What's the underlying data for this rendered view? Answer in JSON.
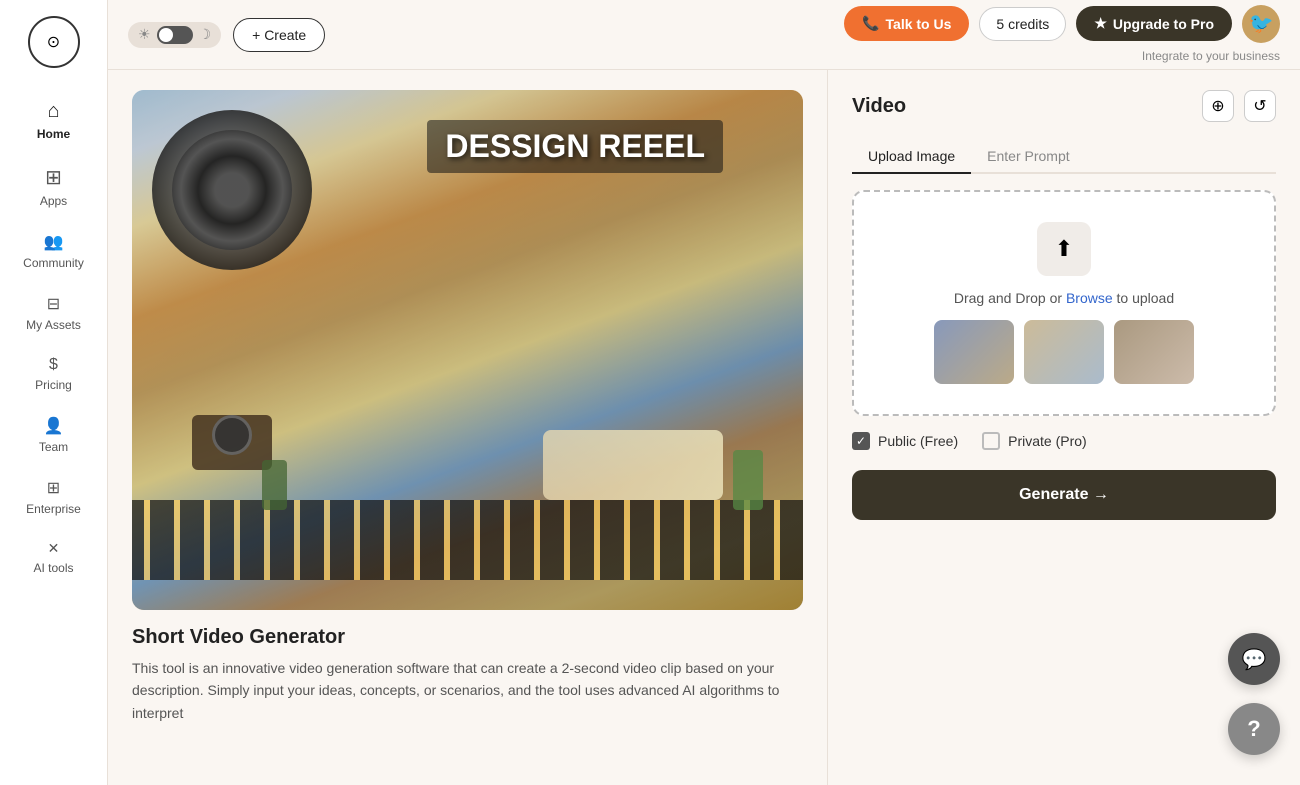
{
  "sidebar": {
    "logo_symbol": "⊙",
    "items": [
      {
        "id": "home",
        "label": "Home",
        "icon": "⌂"
      },
      {
        "id": "apps",
        "label": "Apps",
        "icon": "⊞"
      },
      {
        "id": "community",
        "label": "Community",
        "icon": "👥"
      },
      {
        "id": "my-assets",
        "label": "My Assets",
        "icon": "⊟"
      },
      {
        "id": "pricing",
        "label": "Pricing",
        "icon": "$"
      },
      {
        "id": "team",
        "label": "Team",
        "icon": "👤"
      },
      {
        "id": "enterprise",
        "label": "Enterprise",
        "icon": "⊞"
      },
      {
        "id": "ai-tools",
        "label": "AI tools",
        "icon": "✕"
      }
    ]
  },
  "header": {
    "theme_toggle": {
      "sun_icon": "☀",
      "moon_icon": "☽"
    },
    "create_label": "+ Create",
    "integrate_text": "Integrate to your business",
    "talk_btn_label": "Talk to Us",
    "credits_label": "5 credits",
    "upgrade_label": "Upgrade to Pro",
    "avatar_emoji": "🐦"
  },
  "main": {
    "tool": {
      "title": "Short Video Generator",
      "description": "This tool is an innovative video generation software that can create a 2-second video clip based on your description. Simply input your ideas, concepts, or scenarios, and the tool uses advanced AI algorithms to interpret",
      "preview_overlay": "DESSIGN REEEL"
    },
    "right_panel": {
      "title": "Video",
      "tabs": [
        {
          "id": "upload",
          "label": "Upload Image",
          "active": true
        },
        {
          "id": "prompt",
          "label": "Enter Prompt",
          "active": false
        }
      ],
      "upload": {
        "drag_text": "Drag and Drop or ",
        "browse_text": "Browse",
        "after_text": " to upload",
        "upload_icon": "⬆"
      },
      "options": [
        {
          "id": "public",
          "label": "Public (Free)",
          "checked": true
        },
        {
          "id": "private",
          "label": "Private (Pro)",
          "checked": false
        }
      ],
      "generate_label": "Generate →"
    }
  }
}
